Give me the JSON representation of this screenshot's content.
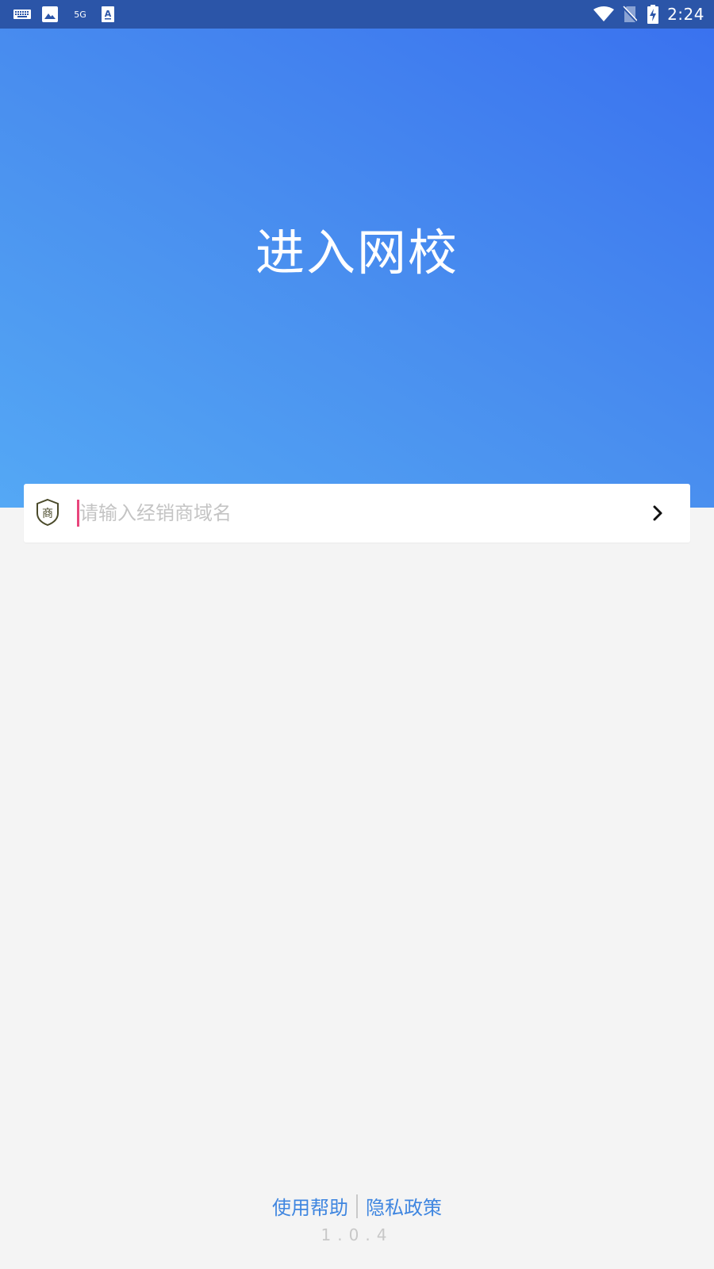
{
  "status_bar": {
    "network_label": "5G",
    "time": "2:24",
    "icons": [
      "keyboard-icon",
      "image-icon",
      "5g-icon",
      "text-a-icon",
      "wifi-icon",
      "no-sim-icon",
      "battery-charging-icon"
    ]
  },
  "hero": {
    "title": "进入网校",
    "gradient_colors": [
      "#3a72ef",
      "#54a8f5"
    ]
  },
  "search": {
    "icon": "shop-badge-icon",
    "icon_text": "商",
    "placeholder": "请输入经销商域名",
    "value": "",
    "submit_icon": "chevron-right-icon"
  },
  "footer": {
    "help_label": "使用帮助",
    "privacy_label": "隐私政策",
    "version": "1.0.4",
    "link_color": "#3f86e0"
  }
}
